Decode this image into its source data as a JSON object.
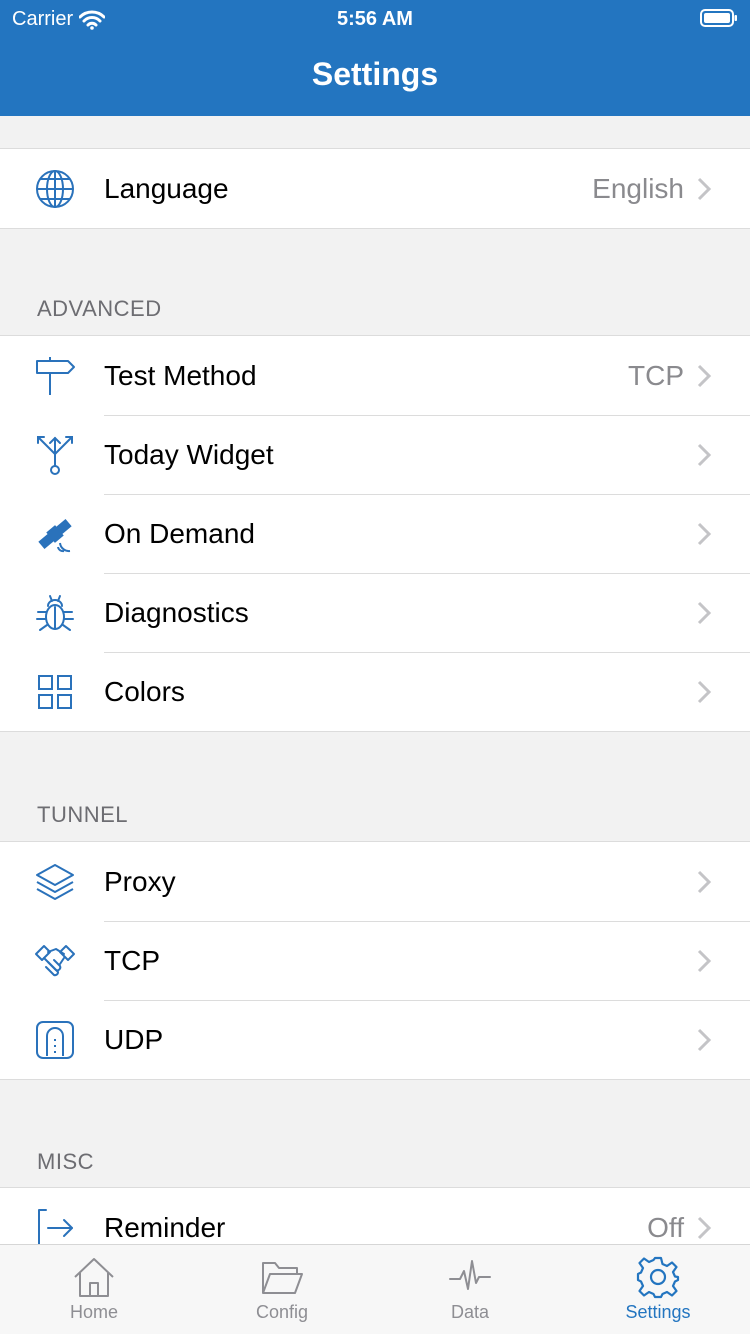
{
  "status_bar": {
    "carrier": "Carrier",
    "time": "5:56 AM"
  },
  "nav": {
    "title": "Settings"
  },
  "general": {
    "language": {
      "label": "Language",
      "value": "English",
      "icon": "globe-icon"
    }
  },
  "advanced": {
    "header": "ADVANCED",
    "items": [
      {
        "label": "Test Method",
        "value": "TCP",
        "icon": "signpost-icon"
      },
      {
        "label": "Today Widget",
        "value": "",
        "icon": "fork-icon"
      },
      {
        "label": "On Demand",
        "value": "",
        "icon": "satellite-icon"
      },
      {
        "label": "Diagnostics",
        "value": "",
        "icon": "bug-icon"
      },
      {
        "label": "Colors",
        "value": "",
        "icon": "grid-icon"
      }
    ]
  },
  "tunnel": {
    "header": "TUNNEL",
    "items": [
      {
        "label": "Proxy",
        "value": "",
        "icon": "layers-icon"
      },
      {
        "label": "TCP",
        "value": "",
        "icon": "handshake-icon"
      },
      {
        "label": "UDP",
        "value": "",
        "icon": "tunnel-icon"
      }
    ]
  },
  "misc": {
    "header": "MISC",
    "items": [
      {
        "label": "Reminder",
        "value": "Off",
        "icon": "exit-arrow-icon"
      }
    ]
  },
  "tabs": [
    {
      "label": "Home",
      "icon": "home-icon",
      "active": false
    },
    {
      "label": "Config",
      "icon": "folder-icon",
      "active": false
    },
    {
      "label": "Data",
      "icon": "pulse-icon",
      "active": false
    },
    {
      "label": "Settings",
      "icon": "gear-icon",
      "active": true
    }
  ],
  "colors": {
    "brand": "#2375c0",
    "icon": "#2a72bb",
    "secondary_text": "#8a8a8e",
    "background": "#f2f2f2"
  }
}
